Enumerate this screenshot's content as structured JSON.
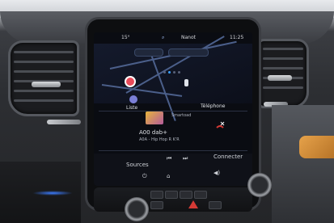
{
  "status_bar": {
    "temperature": "15°",
    "nav_hint": "Nanot",
    "time": "11:25"
  },
  "home": {
    "list_label": "Liste",
    "phone_label": "Téléphone",
    "media_source": "Smartoad",
    "station_name": "A00 dab+",
    "station_info": "A0A - Hip Hop R K'R"
  },
  "softkeys": {
    "sources": "Sources",
    "connect": "Connecter"
  },
  "colors": {
    "accent": "#3aa0ff",
    "hazard": "#d43a35"
  }
}
